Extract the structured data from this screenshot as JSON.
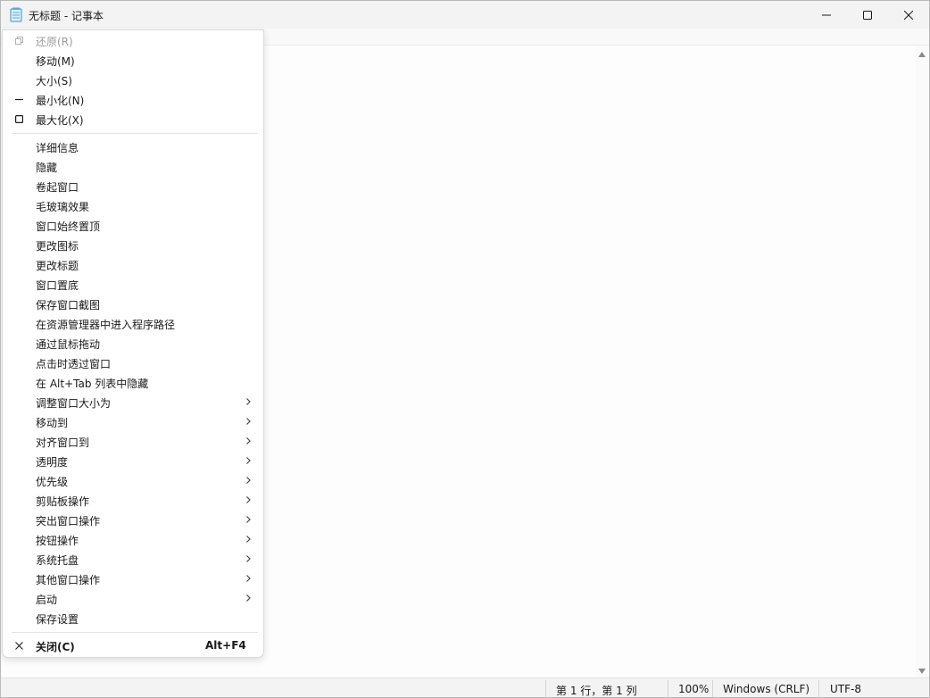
{
  "window": {
    "title": "无标题 - 记事本"
  },
  "system_menu": {
    "group1": [
      {
        "label": "还原(R)",
        "icon": "restore-icon",
        "disabled": true
      },
      {
        "label": "移动(M)",
        "icon": "",
        "disabled": false
      },
      {
        "label": "大小(S)",
        "icon": "",
        "disabled": false
      },
      {
        "label": "最小化(N)",
        "icon": "minimize-icon",
        "disabled": false
      },
      {
        "label": "最大化(X)",
        "icon": "maximize-icon",
        "disabled": false
      }
    ],
    "group2": [
      {
        "label": "详细信息",
        "submenu": false
      },
      {
        "label": "隐藏",
        "submenu": false
      },
      {
        "label": "卷起窗口",
        "submenu": false
      },
      {
        "label": "毛玻璃效果",
        "submenu": false
      },
      {
        "label": "窗口始终置顶",
        "submenu": false
      },
      {
        "label": "更改图标",
        "submenu": false
      },
      {
        "label": "更改标题",
        "submenu": false
      },
      {
        "label": "窗口置底",
        "submenu": false
      },
      {
        "label": "保存窗口截图",
        "submenu": false
      },
      {
        "label": "在资源管理器中进入程序路径",
        "submenu": false
      },
      {
        "label": "通过鼠标拖动",
        "submenu": false
      },
      {
        "label": "点击时透过窗口",
        "submenu": false
      },
      {
        "label": "在 Alt+Tab 列表中隐藏",
        "submenu": false
      },
      {
        "label": "调整窗口大小为",
        "submenu": true
      },
      {
        "label": "移动到",
        "submenu": true
      },
      {
        "label": "对齐窗口到",
        "submenu": true
      },
      {
        "label": "透明度",
        "submenu": true
      },
      {
        "label": "优先级",
        "submenu": true
      },
      {
        "label": "剪贴板操作",
        "submenu": true
      },
      {
        "label": "突出窗口操作",
        "submenu": true
      },
      {
        "label": "按钮操作",
        "submenu": true
      },
      {
        "label": "系统托盘",
        "submenu": true
      },
      {
        "label": "其他窗口操作",
        "submenu": true
      },
      {
        "label": "启动",
        "submenu": true
      },
      {
        "label": "保存设置",
        "submenu": false
      }
    ],
    "close": {
      "label": "关闭(C)",
      "shortcut": "Alt+F4",
      "icon": "close-icon"
    }
  },
  "status_bar": {
    "position": "第 1 行，第 1 列",
    "zoom": "100%",
    "line_ending": "Windows (CRLF)",
    "encoding": "UTF-8"
  }
}
